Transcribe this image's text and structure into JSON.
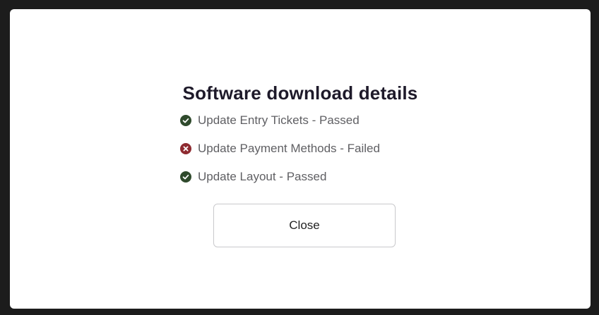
{
  "dialog": {
    "title": "Software download details",
    "items": [
      {
        "label": "Update Entry Tickets - Passed",
        "status": "passed",
        "icon": "check-circle-icon",
        "color": "#2f4a2c"
      },
      {
        "label": "Update Payment Methods - Failed",
        "status": "failed",
        "icon": "x-circle-icon",
        "color": "#8e2a30"
      },
      {
        "label": "Update Layout - Passed",
        "status": "passed",
        "icon": "check-circle-icon",
        "color": "#2f4a2c"
      }
    ],
    "close_label": "Close"
  },
  "colors": {
    "backdrop": "#1c1c1c",
    "dialog_background": "#ffffff",
    "title": "#1e1a2a",
    "item_text": "#5f5f63",
    "passed": "#2f4a2c",
    "failed": "#8e2a30",
    "button_border": "#c9c9cc"
  }
}
